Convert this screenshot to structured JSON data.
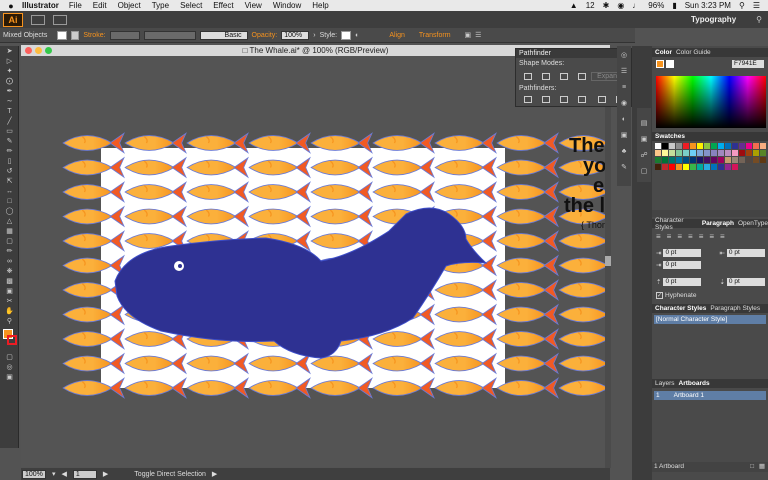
{
  "menubar": {
    "app_name": "Illustrator",
    "items": [
      "File",
      "Edit",
      "Object",
      "Type",
      "Select",
      "Effect",
      "View",
      "Window",
      "Help"
    ],
    "status": {
      "adobe_count": "12",
      "battery": "96%",
      "clock": "Sun 3:23 PM"
    }
  },
  "appbar": {
    "logo": "Ai",
    "workspace": "Typography"
  },
  "control_bar": {
    "selection": "Mixed Objects",
    "stroke_label": "Stroke:",
    "brush_label": "Basic",
    "opacity_label": "Opacity:",
    "opacity_value": "100%",
    "style_label": "Style:",
    "align_label": "Align",
    "transform_label": "Transform"
  },
  "document": {
    "title": "The Whale.ai* @ 100% (RGB/Preview)",
    "artwork_text": [
      "The",
      "yo",
      "e",
      "the l",
      "{ Thom"
    ]
  },
  "status_bar": {
    "zoom": "100%",
    "artboard_num": "1",
    "tool_hint": "Toggle Direct Selection"
  },
  "pathfinder": {
    "title": "Pathfinder",
    "shape_modes": "Shape Modes:",
    "expand": "Expand",
    "pathfinders": "Pathfinders:"
  },
  "color_panel": {
    "tab_color": "Color",
    "tab_guide": "Color Guide",
    "hex_value": "F7941E"
  },
  "swatches": {
    "title": "Swatches",
    "colors": [
      "#ffffff",
      "#000000",
      "#c8c8c8",
      "#8c8c8c",
      "#ed1c24",
      "#f7941e",
      "#fff200",
      "#8dc63f",
      "#00a651",
      "#00aeef",
      "#0072bc",
      "#2e3192",
      "#662d91",
      "#ec008c",
      "#f26c4f",
      "#f9ad81",
      "#fdc689",
      "#fff799",
      "#c4df9b",
      "#82ca9c",
      "#7bcdc8",
      "#6dcff6",
      "#7ea7d8",
      "#8493ca",
      "#8882be",
      "#a187be",
      "#bc8dbf",
      "#f49ac2",
      "#9e0b0f",
      "#a0410d",
      "#aba000",
      "#598527",
      "#1a7b30",
      "#007236",
      "#00746b",
      "#0076a3",
      "#004b80",
      "#003471",
      "#1b1464",
      "#440e62",
      "#630460",
      "#9e005d",
      "#c69c6d",
      "#998675",
      "#736357",
      "#534741",
      "#754c24",
      "#603913",
      "#42210b",
      "#c1272d",
      "#ff0000",
      "#f7931e",
      "#ffff00",
      "#39b54a",
      "#00a99d",
      "#29abe2",
      "#0071bc",
      "#2e3192",
      "#93278f",
      "#d4145a"
    ]
  },
  "panels": {
    "char_styles_tab": "Character Styles",
    "paragraph_tab": "Paragraph",
    "opentype_tab": "OpenType",
    "indent_values": [
      "0 pt",
      "0 pt",
      "0 pt",
      "0 pt",
      "0 pt"
    ],
    "hyphenate": "Hyphenate",
    "char_styles_tab2": "Character Styles",
    "para_styles_tab": "Paragraph Styles",
    "normal_style": "[Normal Character Style]",
    "layers_tab": "Layers",
    "artboards_tab": "Artboards",
    "artboard_row_num": "1",
    "artboard_row_name": "Artboard 1",
    "artboard_count": "1 Artboard"
  }
}
